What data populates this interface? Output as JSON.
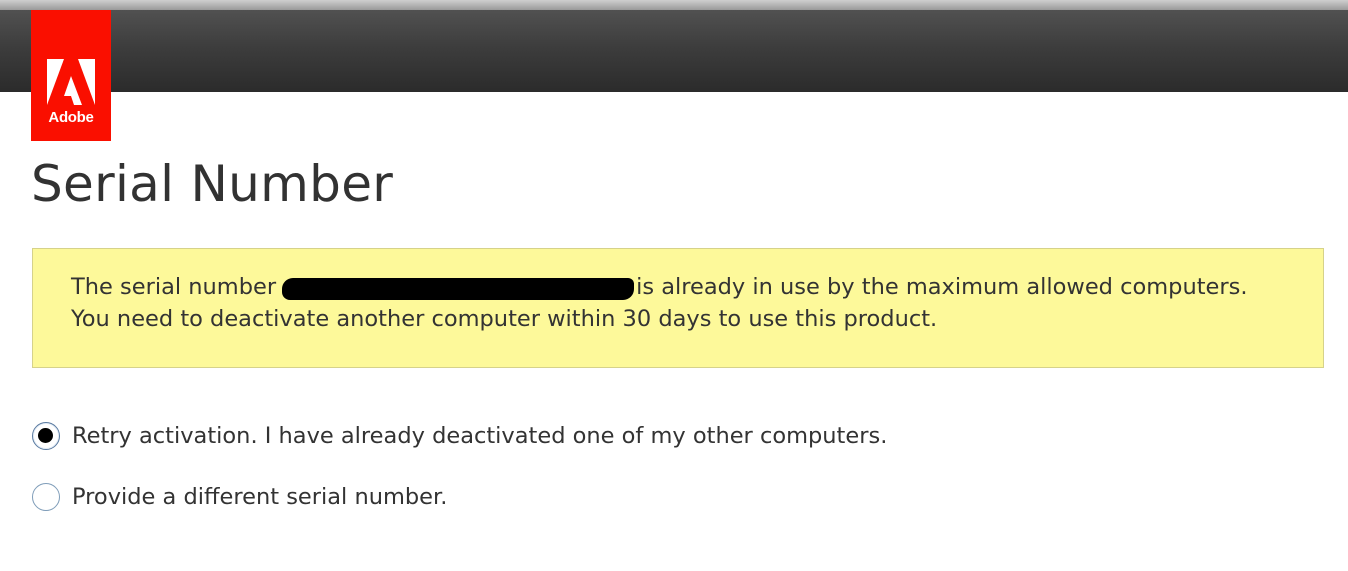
{
  "header": {
    "logo_text": "Adobe",
    "brand_color": "#fa0f00",
    "bar_color": "#3d3d3d"
  },
  "page": {
    "title": "Serial Number"
  },
  "alert": {
    "line1_before": "The serial number",
    "line1_after": "is already in use by the maximum allowed computers.",
    "line2": "You need to deactivate another computer within 30 days to use this product.",
    "background_color": "#fdf99a",
    "redacted": true
  },
  "options": {
    "retry": {
      "label": "Retry activation. I have already deactivated one of my other computers.",
      "selected": true
    },
    "different": {
      "label": "Provide a different serial number.",
      "selected": false
    }
  },
  "icons": {
    "logo": "adobe-logo-icon",
    "selected_radio": "radio-selected-icon",
    "unselected_radio": "radio-unselected-icon"
  }
}
